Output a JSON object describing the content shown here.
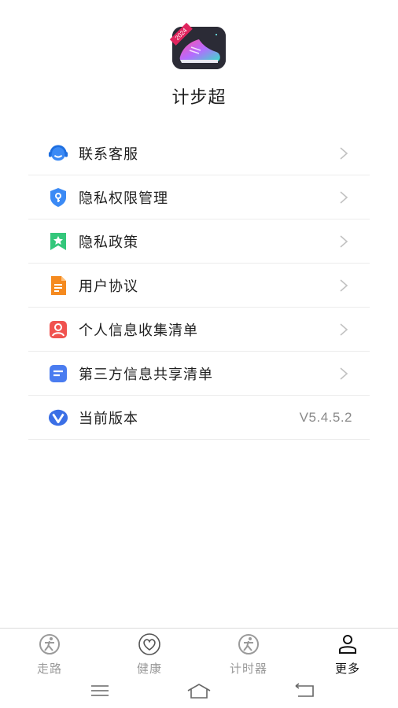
{
  "app": {
    "name": "计步超",
    "icon_badge": "2024",
    "icon_name": "sneaker-app-icon"
  },
  "menu": [
    {
      "label": "联系客服",
      "icon": "customer-service-icon",
      "color": "#3b8af5"
    },
    {
      "label": "隐私权限管理",
      "icon": "privacy-shield-icon",
      "color": "#3b8af5"
    },
    {
      "label": "隐私政策",
      "icon": "policy-bookmark-icon",
      "color": "#34c77b"
    },
    {
      "label": "用户协议",
      "icon": "agreement-document-icon",
      "color": "#f58a1f"
    },
    {
      "label": "个人信息收集清单",
      "icon": "personal-info-icon",
      "color": "#f0524f"
    },
    {
      "label": "第三方信息共享清单",
      "icon": "third-party-list-icon",
      "color": "#4a7cf0"
    }
  ],
  "version": {
    "label": "当前版本",
    "value": "V5.4.5.2",
    "icon": "version-v-icon",
    "color": "#3b6fe6"
  },
  "tabs": [
    {
      "label": "走路",
      "icon": "walk-icon",
      "active": false
    },
    {
      "label": "健康",
      "icon": "heart-icon",
      "active": false
    },
    {
      "label": "计时器",
      "icon": "walk-timer-icon",
      "active": false
    },
    {
      "label": "更多",
      "icon": "person-icon",
      "active": true
    }
  ],
  "system_nav": [
    "menu-lines-icon",
    "home-icon",
    "back-icon"
  ]
}
